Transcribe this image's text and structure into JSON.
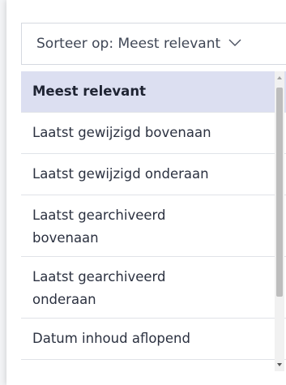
{
  "sort": {
    "button_label": "Sorteer op: Meest relevant"
  },
  "options": [
    {
      "label": "Meest relevant",
      "selected": true
    },
    {
      "label": "Laatst gewijzigd bovenaan",
      "selected": false
    },
    {
      "label": "Laatst gewijzigd onderaan",
      "selected": false
    },
    {
      "label": "Laatst gearchiveerd bovenaan",
      "selected": false
    },
    {
      "label": "Laatst gearchiveerd onderaan",
      "selected": false
    },
    {
      "label": "Datum inhoud aflopend",
      "selected": false
    }
  ],
  "colors": {
    "selected_background": "#dcdff1",
    "text": "#2b3140",
    "border": "#d5d9e0"
  },
  "icons": {
    "dropdown": "chevron-down-icon",
    "scroll_up": "triangle-up-icon",
    "scroll_down": "triangle-down-icon"
  }
}
